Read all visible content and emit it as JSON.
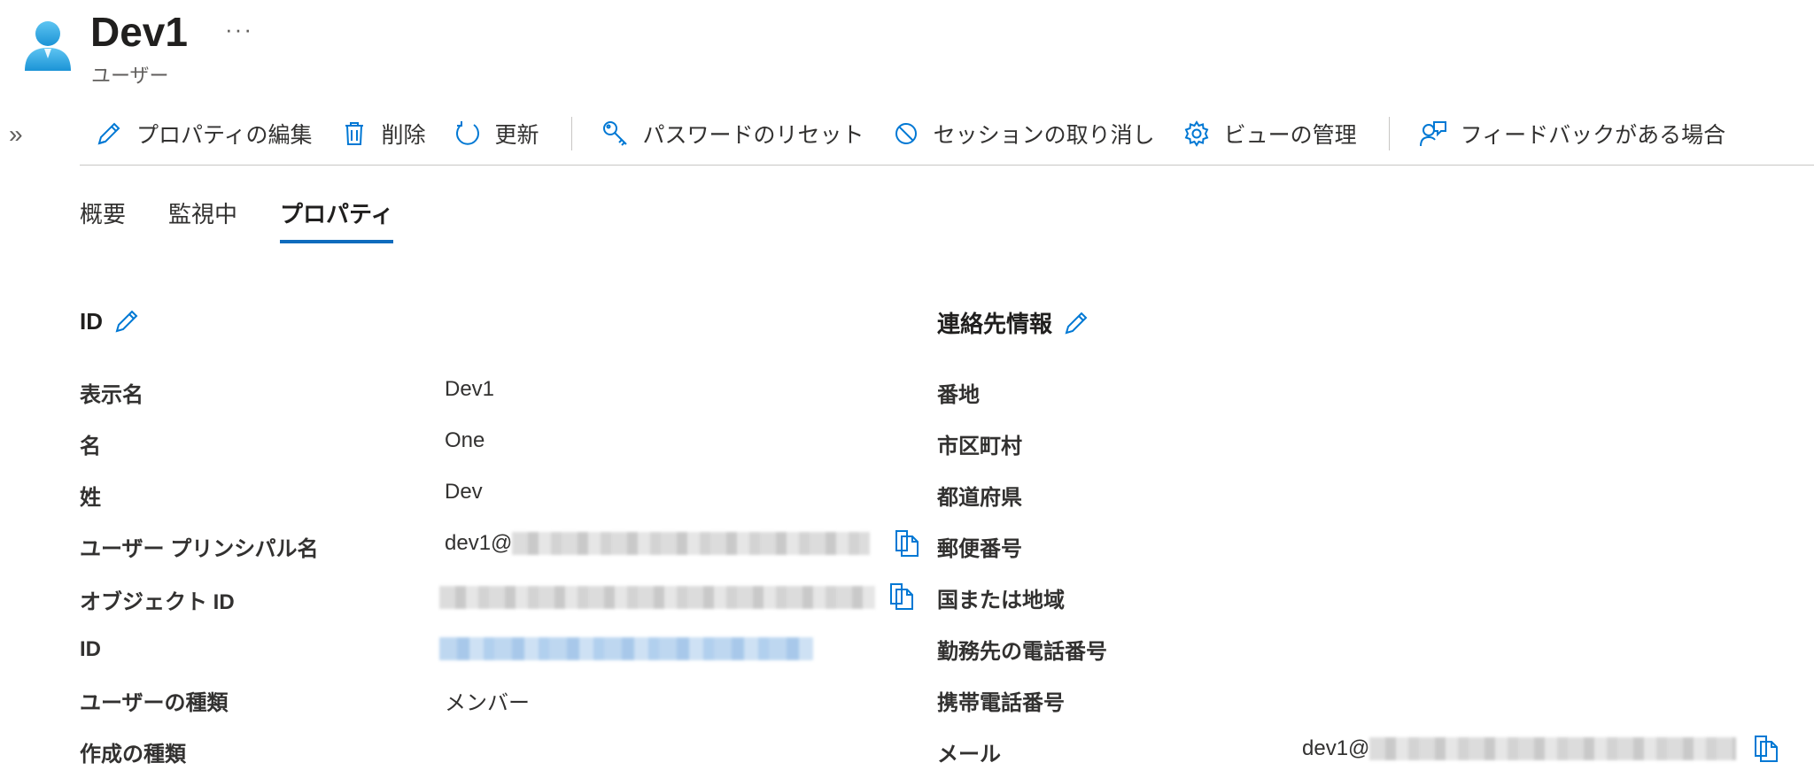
{
  "header": {
    "title": "Dev1",
    "subtitle": "ユーザー",
    "more_label": "···"
  },
  "toolbar": {
    "expand_label": "»",
    "items": [
      {
        "label": "プロパティの編集",
        "icon": "pencil-icon"
      },
      {
        "label": "削除",
        "icon": "trash-icon"
      },
      {
        "label": "更新",
        "icon": "refresh-icon"
      },
      {
        "label": "パスワードのリセット",
        "icon": "key-icon"
      },
      {
        "label": "セッションの取り消し",
        "icon": "block-icon"
      },
      {
        "label": "ビューの管理",
        "icon": "gear-icon"
      },
      {
        "label": "フィードバックがある場合",
        "icon": "feedback-icon"
      }
    ]
  },
  "tabs": [
    {
      "label": "概要",
      "active": false
    },
    {
      "label": "監視中",
      "active": false
    },
    {
      "label": "プロパティ",
      "active": true
    }
  ],
  "identity": {
    "title": "ID",
    "rows": [
      {
        "label": "表示名",
        "value": "Dev1"
      },
      {
        "label": "名",
        "value": "One"
      },
      {
        "label": "姓",
        "value": "Dev"
      },
      {
        "label": "ユーザー プリンシパル名",
        "value": "dev1@"
      },
      {
        "label": "オブジェクト ID",
        "value": ""
      },
      {
        "label": "ID",
        "value": ""
      },
      {
        "label": "ユーザーの種類",
        "value": "メンバー"
      },
      {
        "label": "作成の種類",
        "value": ""
      }
    ]
  },
  "contact": {
    "title": "連絡先情報",
    "rows": [
      {
        "label": "番地",
        "value": ""
      },
      {
        "label": "市区町村",
        "value": ""
      },
      {
        "label": "都道府県",
        "value": ""
      },
      {
        "label": "郵便番号",
        "value": ""
      },
      {
        "label": "国または地域",
        "value": ""
      },
      {
        "label": "勤務先の電話番号",
        "value": ""
      },
      {
        "label": "携帯電話番号",
        "value": ""
      },
      {
        "label": "メール",
        "value": "dev1@"
      }
    ]
  },
  "colors": {
    "accent": "#0f6cbd",
    "icon_blue": "#0078d4",
    "text": "#323130"
  }
}
